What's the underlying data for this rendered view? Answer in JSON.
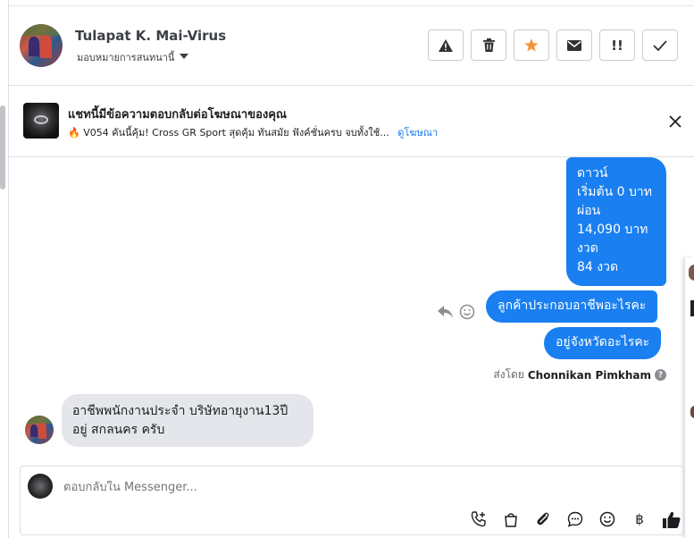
{
  "header": {
    "contact_name": "Tulapat K. Mai-Virus",
    "assign_label": "มอบหมายการสนทนานี้",
    "toolbar": [
      "alert-icon",
      "trash-icon",
      "star-icon",
      "mail-icon",
      "important-icon",
      "check-icon"
    ],
    "star_color": "#f7923b"
  },
  "ad": {
    "title": "แชทนี้มีข้อความตอบกลับต่อโฆษณาของคุณ",
    "fire": "🔥",
    "subtitle": "V054 คันนี้คุ้ม! Cross GR Sport สุดคุ้ม ทันสมัย ฟังค์ชั่นครบ จบทั้งใช้...",
    "link": "ดูโฆษณา"
  },
  "messages": {
    "out1": [
      "ดาวน์",
      "เริ่มต้น 0 บาท",
      "ผ่อน",
      "14,090 บาท",
      "งวด",
      "84 งวด"
    ],
    "out2": "ลูกค้าประกอบอาชีพอะไรคะ",
    "out3": "อยู่จังหวัดอะไรคะ",
    "sent_by_prefix": "ส่งโดย",
    "sent_by_name": "Chonnikan Pimkham",
    "in1_line1": "อาชีพพนักงานประจำ บริษัทอายุงาน13ปี",
    "in1_line2": "อยู่ สกลนคร ครับ",
    "bubble_color": "#1a7ff0"
  },
  "composer": {
    "placeholder": "ตอบกลับใน Messenger...",
    "baht": "฿"
  }
}
